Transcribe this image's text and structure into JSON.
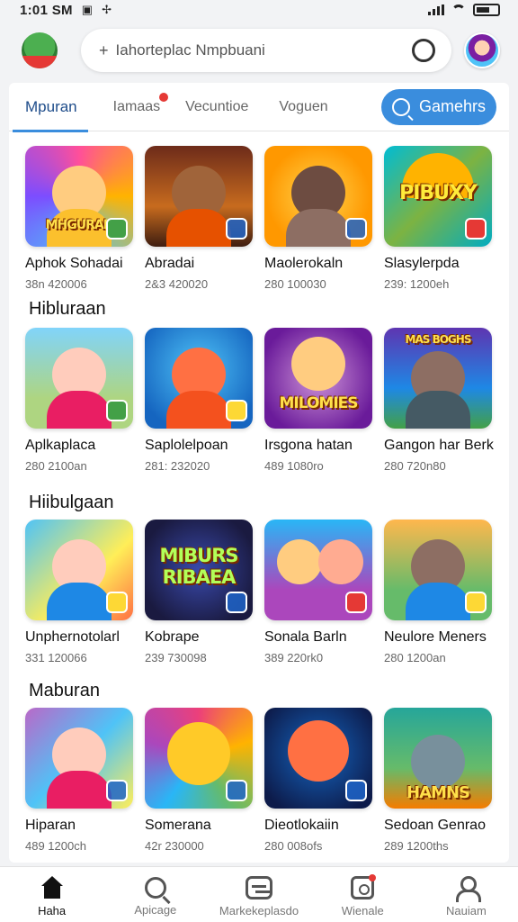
{
  "status": {
    "time": "1:01 SM",
    "icons": [
      "photo-icon",
      "bolt-icon",
      "signal-icon",
      "wifi-icon",
      "battery-icon"
    ]
  },
  "header": {
    "search_placeholder": "Iahorteplac Nmpbuani"
  },
  "tabs": [
    {
      "label": "Mpuran",
      "active": true,
      "badge": false
    },
    {
      "label": "Iamaas",
      "active": false,
      "badge": true
    },
    {
      "label": "Vecuntioe",
      "active": false,
      "badge": false
    },
    {
      "label": "Voguen",
      "active": false,
      "badge": false
    }
  ],
  "games_button": {
    "label": "Gamehrs"
  },
  "sections": [
    {
      "title": "",
      "apps": [
        {
          "name": "Aphok Sohadai",
          "meta": "38n 420006",
          "art": "MHGURAH"
        },
        {
          "name": "Abradai",
          "meta": "2&3 420020",
          "art": ""
        },
        {
          "name": "Maolerokaln",
          "meta": "280 100030",
          "art": ""
        },
        {
          "name": "Slasylerpda",
          "meta": "239: 1200eh",
          "art": "PIBUXY"
        }
      ]
    },
    {
      "title": "Hibluraan",
      "apps": [
        {
          "name": "Aplkaplaca",
          "meta": "280 2100an",
          "art": ""
        },
        {
          "name": "Saplolelpoan",
          "meta": "281: 232020",
          "art": ""
        },
        {
          "name": "Irsgona hatan",
          "meta": "489 1080ro",
          "art": "MILOMIES"
        },
        {
          "name": "Gangon har Berk",
          "meta": "280 720n80",
          "art": "MAS BOGHS"
        }
      ]
    },
    {
      "title": "Hiibulgaan",
      "apps": [
        {
          "name": "Unphernotolarl",
          "meta": "331 120066",
          "art": ""
        },
        {
          "name": "Kobrape",
          "meta": "239 730098",
          "art": "MIBURS RIBAEA"
        },
        {
          "name": "Sonala Barln",
          "meta": "389 220rk0",
          "art": ""
        },
        {
          "name": "Neulore Meners",
          "meta": "280 1200an",
          "art": ""
        }
      ]
    },
    {
      "title": "Maburan",
      "apps": [
        {
          "name": "Hiparan",
          "meta": "489 1200ch",
          "art": ""
        },
        {
          "name": "Somerana",
          "meta": "42r 230000",
          "art": ""
        },
        {
          "name": "Dieotlokaiin",
          "meta": "280 008ofs",
          "art": ""
        },
        {
          "name": "Sedoan Genrao",
          "meta": "289 1200ths",
          "art": "HAMNS"
        }
      ]
    }
  ],
  "bottom_nav": [
    {
      "label": "Haha",
      "icon": "home-icon",
      "active": true
    },
    {
      "label": "Apicage",
      "icon": "search-icon",
      "active": false
    },
    {
      "label": "Markekeplasdo",
      "icon": "marketplace-icon",
      "active": false
    },
    {
      "label": "Wienale",
      "icon": "window-icon",
      "active": false
    },
    {
      "label": "Nauiam",
      "icon": "profile-icon",
      "active": false
    }
  ],
  "colors": {
    "accent": "#3a8ddd",
    "tab_active_text": "#1e4c8a",
    "badge": "#e53935"
  }
}
